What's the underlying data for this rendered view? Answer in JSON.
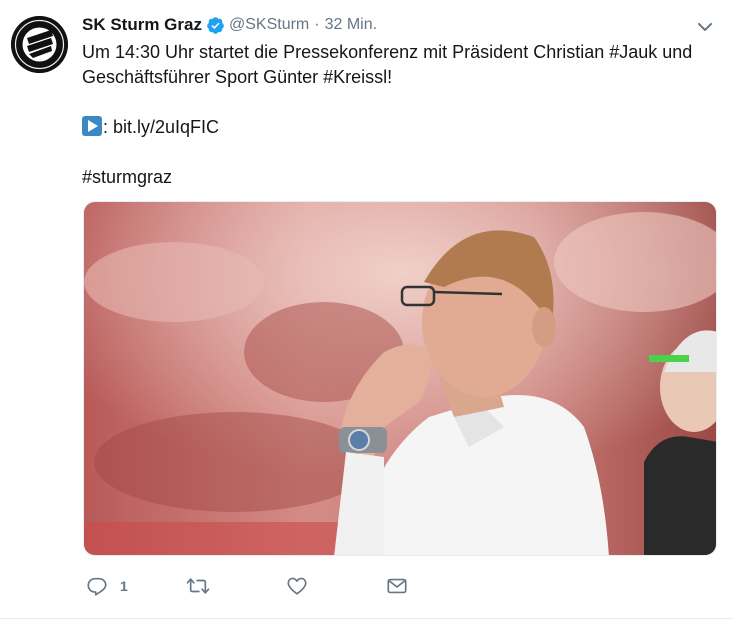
{
  "tweet": {
    "display_name": "SK Sturm Graz",
    "handle": "@SKSturm",
    "separator": "·",
    "time": "32 Min.",
    "text_line1": "Um 14:30 Uhr startet die Pressekonferenz mit Präsident Christian #Jauk und",
    "text_line2": "Geschäftsführer Sport Günter #Kreissl!",
    "link_prefix": ": ",
    "link": "bit.ly/2uIqFIC",
    "hashtag": "#sturmgraz",
    "reply_count": "1"
  },
  "icons": {
    "verified": "verified-badge-icon",
    "caret": "chevron-down-icon",
    "reply": "reply-icon",
    "retweet": "retweet-icon",
    "like": "heart-icon",
    "dm": "envelope-icon",
    "play": "play-button-emoji"
  },
  "colors": {
    "verified": "#1da1f2",
    "secondary_text": "#657786",
    "primary_text": "#14171a",
    "play_emoji": "#3b88c3"
  }
}
